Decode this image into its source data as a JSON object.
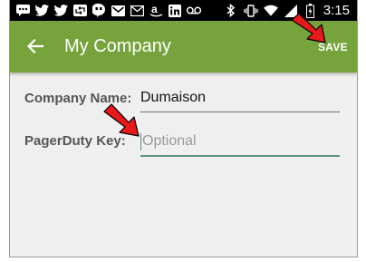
{
  "status_bar": {
    "time": "3:15",
    "icons": [
      "chat-icon",
      "twitter-icon",
      "twitter-icon",
      "retweet-icon",
      "hangouts-icon",
      "gmail-icon",
      "mail-icon",
      "amazon-icon",
      "linkedin-icon",
      "voicemail-icon",
      "bluetooth-icon",
      "vibrate-icon",
      "wifi-icon",
      "signal-icon",
      "battery-icon"
    ]
  },
  "app_bar": {
    "title": "My Company",
    "save_label": "SAVE",
    "color": "#77a33c"
  },
  "form": {
    "company_name": {
      "label": "Company Name:",
      "value": "Dumaison"
    },
    "pagerduty_key": {
      "label": "PagerDuty Key:",
      "value": "",
      "placeholder": "Optional"
    }
  },
  "colors": {
    "background": "#efefef",
    "accent": "#5e8f86",
    "annotation_arrow": "#e8191b"
  }
}
